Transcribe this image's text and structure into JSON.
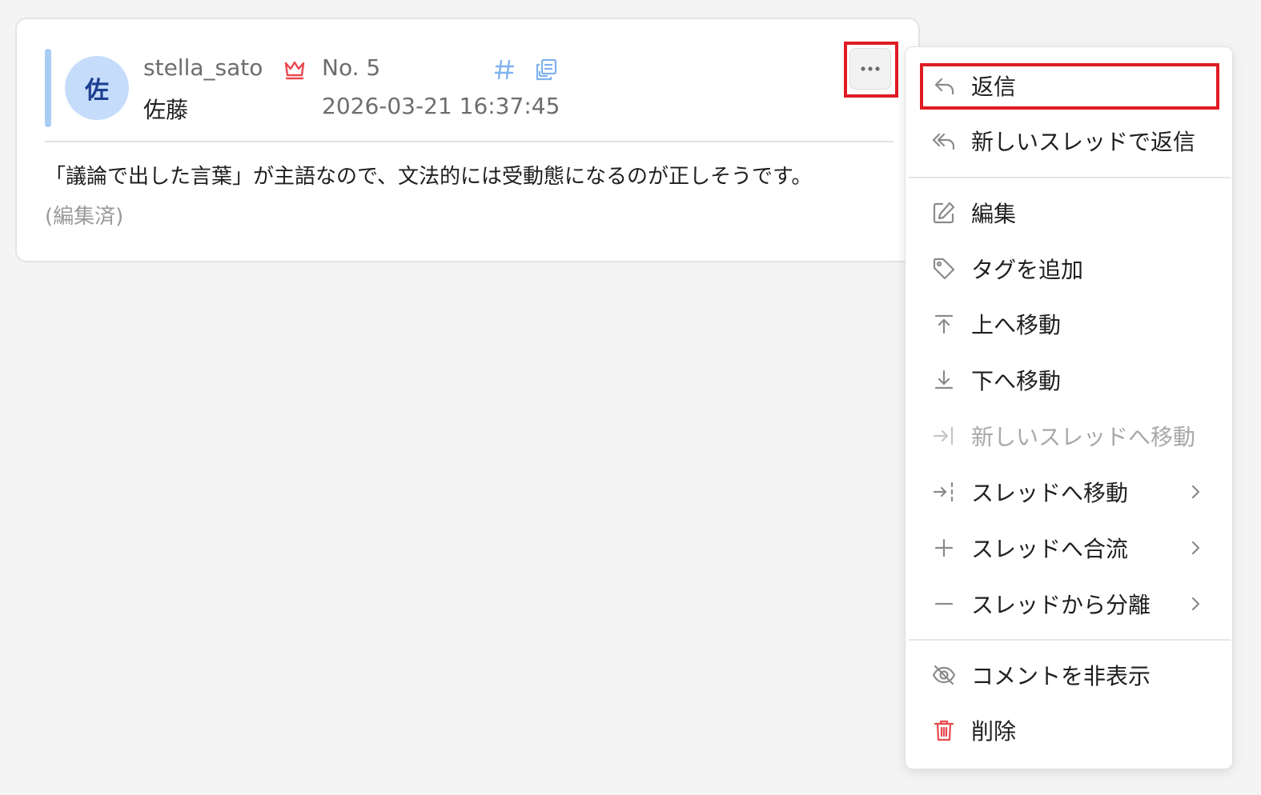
{
  "comment": {
    "avatar_char": "佐",
    "username": "stella_sato",
    "display_name": "佐藤",
    "post_number": "No. 5",
    "timestamp": "2026-03-21 16:37:45",
    "message": "「議論で出した言葉」が主語なので、文法的には受動態になるのが正しそうです。",
    "edited_label": "(編集済)",
    "colors": {
      "accent_bar": "#a9ccf7",
      "avatar_bg": "#c6dcfb",
      "crown": "#e8494f",
      "icon_blue": "#7fb1ee",
      "highlight": "#e01b24"
    }
  },
  "menu": {
    "items": [
      {
        "label": "返信",
        "icon": "reply-icon"
      },
      {
        "label": "新しいスレッドで返信",
        "icon": "reply-all-icon"
      },
      {
        "label": "編集",
        "icon": "edit-icon"
      },
      {
        "label": "タグを追加",
        "icon": "tag-icon"
      },
      {
        "label": "上へ移動",
        "icon": "move-top-icon"
      },
      {
        "label": "下へ移動",
        "icon": "move-bottom-icon"
      },
      {
        "label": "新しいスレッドへ移動",
        "icon": "move-to-new-thread-icon",
        "disabled": true
      },
      {
        "label": "スレッドへ移動",
        "icon": "move-to-thread-icon",
        "submenu": true
      },
      {
        "label": "スレッドへ合流",
        "icon": "plus-icon",
        "submenu": true
      },
      {
        "label": "スレッドから分離",
        "icon": "minus-icon",
        "submenu": true
      },
      {
        "label": "コメントを非表示",
        "icon": "eye-off-icon"
      },
      {
        "label": "削除",
        "icon": "trash-icon",
        "danger": true
      }
    ]
  }
}
